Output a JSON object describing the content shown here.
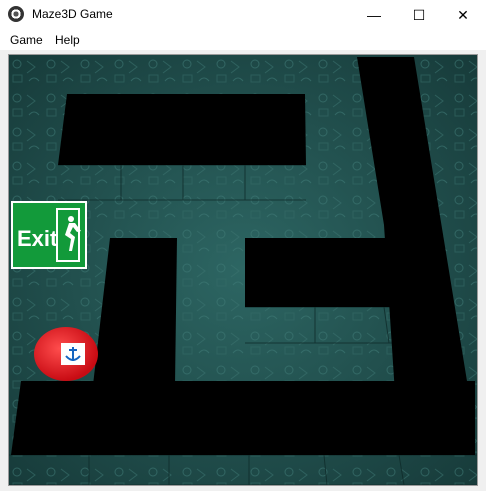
{
  "window": {
    "title": "Maze3D Game",
    "controls": {
      "minimize": "—",
      "maximize": "☐",
      "close": "✕"
    }
  },
  "menu": {
    "items": [
      "Game",
      "Help"
    ]
  },
  "game": {
    "exit_sign": {
      "text": "Exit",
      "colors": {
        "bg": "#129a3a",
        "fg": "#ffffff"
      }
    },
    "player": {
      "icon": "anchor-icon",
      "color": "#e0141c"
    },
    "colors": {
      "floor": "#1f4a49",
      "wall": "#000000"
    }
  }
}
